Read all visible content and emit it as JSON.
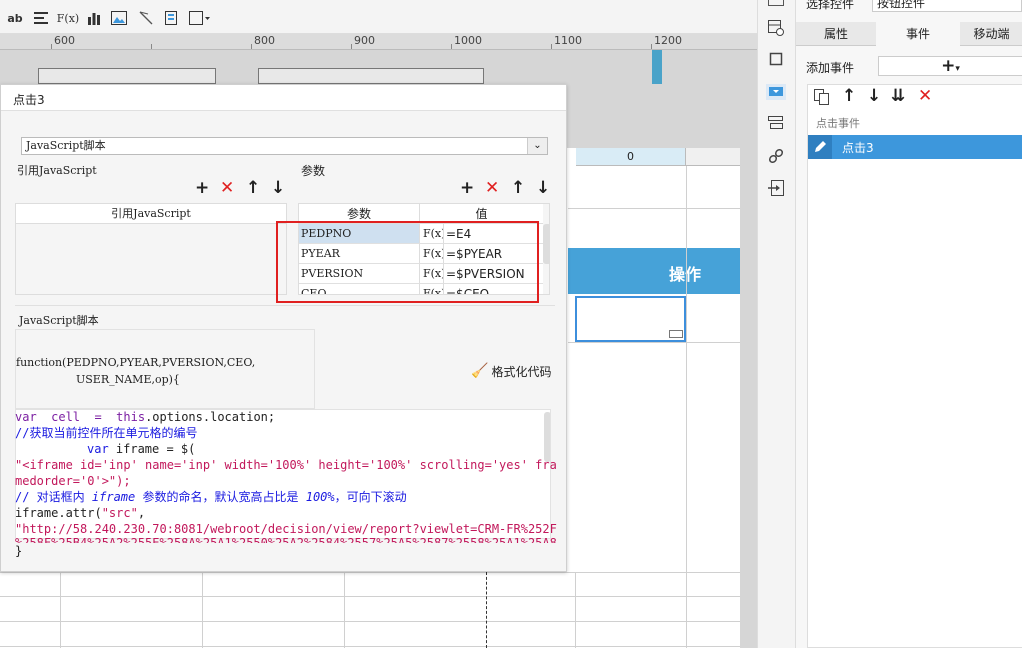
{
  "toolbar": {
    "text_label": "ab",
    "fx_label": "F(x)"
  },
  "ruler": {
    "marks": [
      "600",
      "800",
      "900",
      "1000",
      "1100",
      "1200"
    ]
  },
  "sheet": {
    "col_header": "0",
    "operation_header": "操作"
  },
  "right_panel": {
    "select_control_label": "选择控件",
    "button_control_value": "按钮控件",
    "tabs": [
      "属性",
      "事件",
      "移动端"
    ],
    "add_event_label": "添加事件",
    "add_symbol": "+",
    "event_section_title": "点击事件",
    "event_item": "点击3"
  },
  "dialog": {
    "title": "点击3",
    "type_select": "JavaScript脚本",
    "ref_js_title": "引用JavaScript",
    "params_title": "参数",
    "ref_js_col": "引用JavaScript",
    "params_col_name": "参数",
    "params_col_value": "值",
    "params": [
      {
        "name": "PEDPNO",
        "fx": "F(x)",
        "value": "=E4"
      },
      {
        "name": "PYEAR",
        "fx": "F(x)",
        "value": "=$PYEAR"
      },
      {
        "name": "PVERSION",
        "fx": "F(x)",
        "value": "=$PVERSION"
      },
      {
        "name": "CEO",
        "fx": "F(x)",
        "value": "=$CEO"
      }
    ],
    "script_title": "JavaScript脚本",
    "function_line1": "function(PEDPNO,PYEAR,PVERSION,CEO,",
    "function_line2": "USER_NAME,op){",
    "format_button": "格式化代码",
    "code": {
      "l1_kw": "var",
      "l1_rest": "  cell  =  ",
      "l1_this": "this",
      "l1_end": ".options.location;",
      "l2": "//获取当前控件所在单元格的编号",
      "l3_kw": "var",
      "l3_rest": " iframe = $(",
      "l4": "\"<iframe id='inp' name='inp' width='100%' height='100%' scrolling='yes' fra",
      "l5": "medorder='0'>\");",
      "l6_a": "// 对话框内 ",
      "l6_b": "iframe",
      "l6_c": " 参数的命名，默认宽高占比是 ",
      "l6_d": "100%",
      "l6_e": "，可向下滚动",
      "l7_a": "iframe.attr(",
      "l7_b": "\"src\"",
      "l7_c": ",",
      "l8": "\"http://58.240.230.70:8081/webroot/decision/view/report?viewlet=CRM-FR%252F",
      "l9": "%258F%25B4%25A2%255E%258A%25A1%2550%25A2%2584%2557%25A5%2587%2558%25A1%25A8",
      "l10": "}"
    }
  },
  "colors": {
    "accent": "#3d97dc",
    "highlight_red": "#e02020",
    "event_item_bg": "#3d97dc",
    "sheet_header": "#46a2d8"
  }
}
